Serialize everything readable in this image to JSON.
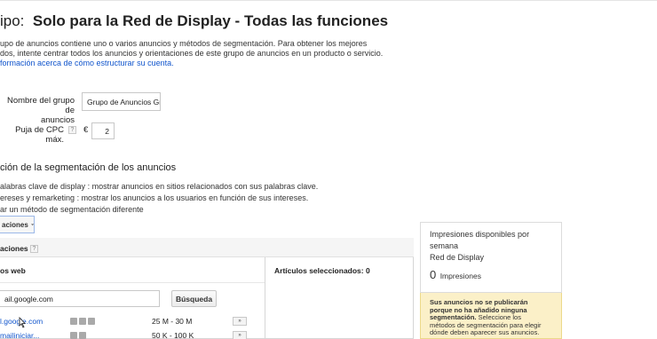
{
  "header": {
    "label": "ipo:",
    "title": "Solo para la Red de Display - Todas las funciones"
  },
  "description": {
    "line1": "upo de anuncios contiene uno o varios anuncios y métodos de segmentación. Para obtener los mejores",
    "line2": "dos, intente centrar todos los anuncios y orientaciones de este grupo de anuncios en un producto o servicio.",
    "link": "formación acerca de cómo estructurar su cuenta."
  },
  "form": {
    "group_name_label_1": "Nombre del grupo de",
    "group_name_label_2": "anuncios",
    "group_name_value": "Grupo de Anuncios Gm",
    "cpc_label": "Puja de CPC máx.",
    "help_glyph": "?",
    "currency": "€",
    "cpc_value": "2"
  },
  "targeting": {
    "section_title": "ción de la segmentación de los anuncios",
    "option1_name": "alabras clave de display",
    "option1_desc": ": mostrar anuncios en sitios relacionados con sus palabras clave.",
    "option2_name": "ereses y remarketing",
    "option2_desc": ": mostrar los anuncios a los usuarios en función de sus intereses.",
    "option3": "ar un método de segmentación diferente",
    "dropdown_label": "aciones"
  },
  "placements": {
    "header": "aciones",
    "help_glyph": "?",
    "col_websites": "os web",
    "col_selected": "Artículos seleccionados: 0",
    "search_value": "ail.google.com",
    "search_button": "Búsqueda",
    "rows": [
      {
        "site": "l.google.com",
        "range": "25 M - 30 M",
        "add": "»"
      },
      {
        "site": "mailiniciar...",
        "range": "50 K - 100 K",
        "add": "»"
      }
    ]
  },
  "sidebar": {
    "impressions_title_1": "Impresiones disponibles por",
    "impressions_title_2": "semana",
    "network": "Red de Display",
    "impressions_count": "0",
    "impressions_unit": "Impresiones",
    "warning_bold_1": "Sus anuncios no se publicarán",
    "warning_bold_2": "porque no ha añadido ninguna",
    "warning_bold_3": "segmentación.",
    "warning_rest_1": "Seleccione los",
    "warning_rest_2": "métodos de segmentación para elegir",
    "warning_rest_3": "dónde deben aparecer sus anuncios."
  },
  "colors": {
    "link": "#1155cc",
    "warning_bg": "#fbf0c8",
    "panel_header_bg": "#f5f5f5"
  },
  "icons": [
    "help-icon",
    "dropdown-arrow-icon",
    "site-type-icon",
    "add-arrow-icon",
    "cursor-icon"
  ]
}
